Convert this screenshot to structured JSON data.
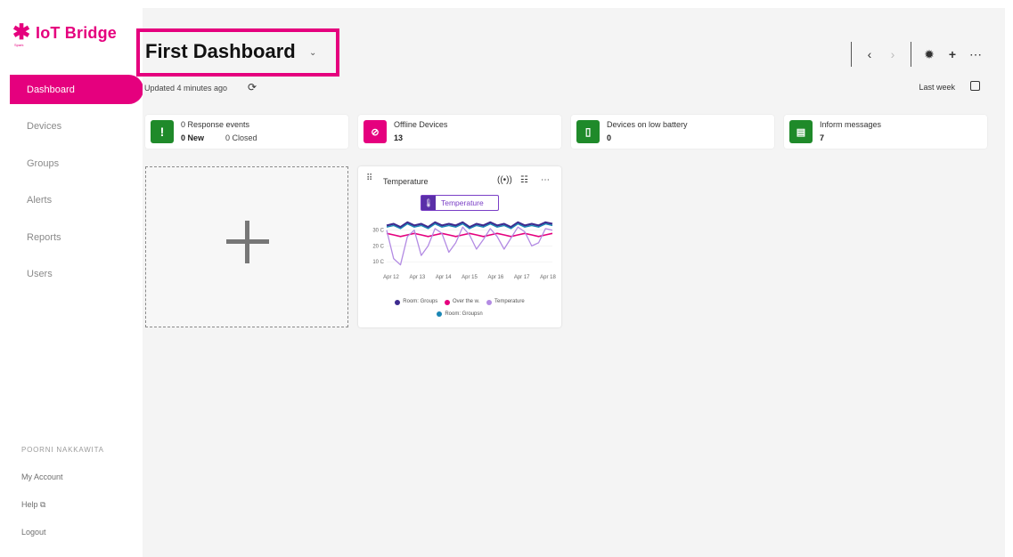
{
  "brand": {
    "name": "IoT Bridge",
    "sub": "Spark"
  },
  "nav": {
    "items": [
      {
        "label": "Dashboard",
        "active": true
      },
      {
        "label": "Devices"
      },
      {
        "label": "Groups"
      },
      {
        "label": "Alerts"
      },
      {
        "label": "Reports"
      },
      {
        "label": "Users"
      }
    ]
  },
  "account": {
    "user": "POORNI NAKKAWITA",
    "my_account": "My Account",
    "help": "Help ⧉",
    "logout": "Logout"
  },
  "header": {
    "title": "First Dashboard",
    "updated": "Updated 4 minutes ago",
    "range": "Last week"
  },
  "stats": [
    {
      "title": "0 Response events",
      "value": "0 New",
      "value2": "0 Closed",
      "icon": "exclamation-icon",
      "color": "#1f8a2a"
    },
    {
      "title": "Offline Devices",
      "value": "13",
      "icon": "offline-icon",
      "color": "#e5007e"
    },
    {
      "title": "Devices on low battery",
      "value": "0",
      "icon": "battery-icon",
      "color": "#1f8a2a"
    },
    {
      "title": "Inform messages",
      "value": "7",
      "icon": "message-icon",
      "color": "#1f8a2a"
    }
  ],
  "widget": {
    "title": "Temperature",
    "chip": "Temperature",
    "legend": [
      {
        "name": "Room: Groups",
        "color": "#3d2b8f"
      },
      {
        "name": "Over the w.",
        "color": "#e5007e"
      },
      {
        "name": "Temperature",
        "color": "#b38be3"
      },
      {
        "name": "Room: Groupsn",
        "color": "#1a86b4"
      }
    ]
  },
  "chart_data": {
    "type": "line",
    "x": [
      "Apr 12",
      "Apr 13",
      "Apr 14",
      "Apr 15",
      "Apr 16",
      "Apr 17",
      "Apr 18"
    ],
    "yticks": [
      "10 C",
      "20 C",
      "30 C"
    ],
    "ylim": [
      5,
      40
    ],
    "series": [
      {
        "name": "Room: Groups",
        "color": "#3d2b8f",
        "values": [
          33,
          34,
          32,
          35,
          33,
          34,
          32,
          35,
          33,
          34,
          33,
          35,
          32,
          34,
          33,
          35,
          33,
          34,
          32,
          35,
          33,
          34,
          33,
          35,
          34
        ]
      },
      {
        "name": "Room: Groupsn",
        "color": "#1a86b4",
        "values": [
          32,
          33,
          31,
          34,
          32,
          33,
          31,
          34,
          32,
          33,
          32,
          34,
          31,
          33,
          32,
          34,
          32,
          33,
          31,
          34,
          32,
          33,
          32,
          34,
          33
        ]
      },
      {
        "name": "Over the w.",
        "color": "#e5007e",
        "values": [
          28,
          27,
          26,
          27,
          28,
          27,
          26,
          27,
          28,
          27,
          26,
          27,
          28,
          27,
          26,
          27,
          28,
          27,
          26,
          27,
          28,
          27,
          26,
          27,
          28
        ]
      },
      {
        "name": "Temperature",
        "color": "#b38be3",
        "values": [
          30,
          12,
          8,
          26,
          30,
          14,
          20,
          31,
          28,
          16,
          22,
          32,
          27,
          18,
          24,
          31,
          26,
          18,
          25,
          32,
          29,
          20,
          22,
          31,
          30
        ]
      }
    ]
  }
}
